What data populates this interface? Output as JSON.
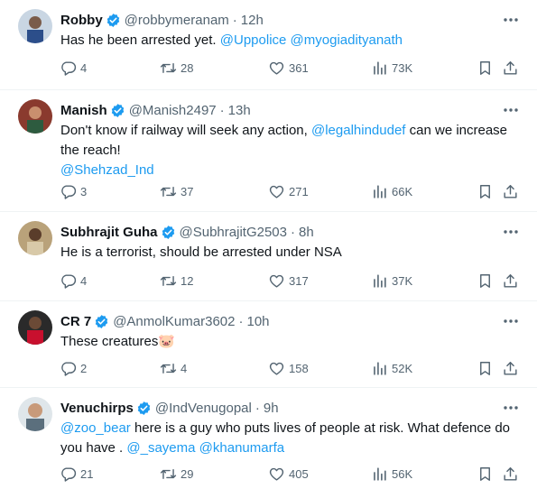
{
  "tweets": [
    {
      "name": "Robby",
      "handle": "@robbymeranam",
      "dot": "·",
      "time": "12h",
      "text1": "Has he been arrested yet. ",
      "mention1": "@Uppolice",
      "text2": " ",
      "mention2": "@myogiadityanath",
      "replies": "4",
      "retweets": "28",
      "likes": "361",
      "views": "73K"
    },
    {
      "name": "Manish",
      "handle": "@Manish2497",
      "dot": "·",
      "time": "13h",
      "text1": "Don't know if railway will seek any action, ",
      "mention1": "@legalhindudef",
      "text2": " can we increase the reach!",
      "mention2": "@Shehzad_Ind",
      "replies": "3",
      "retweets": "37",
      "likes": "271",
      "views": "66K"
    },
    {
      "name": "Subhrajit Guha",
      "handle": "@SubhrajitG2503",
      "dot": "·",
      "time": "8h",
      "text1": "He is a terrorist, should be arrested under NSA",
      "replies": "4",
      "retweets": "12",
      "likes": "317",
      "views": "37K"
    },
    {
      "name": "CR 7",
      "handle": "@AnmolKumar3602",
      "dot": "·",
      "time": "10h",
      "text1": "These creatures",
      "emoji": "🐷",
      "replies": "2",
      "retweets": "4",
      "likes": "158",
      "views": "52K"
    },
    {
      "name": "Venuchirps",
      "handle": "@IndVenugopal",
      "dot": "·",
      "time": "9h",
      "mention1": "@zoo_bear",
      "text1": " here is a guy who puts lives of people at risk. What defence do you have . ",
      "mention2": "@_sayema",
      "text2": " ",
      "mention3": "@khanumarfa",
      "replies": "21",
      "retweets": "29",
      "likes": "405",
      "views": "56K"
    }
  ],
  "colors": {
    "text": "#0f1419",
    "secondary": "#536471",
    "link": "#1d9bf0",
    "verified": "#1d9bf0",
    "divider": "#eff3f4"
  }
}
